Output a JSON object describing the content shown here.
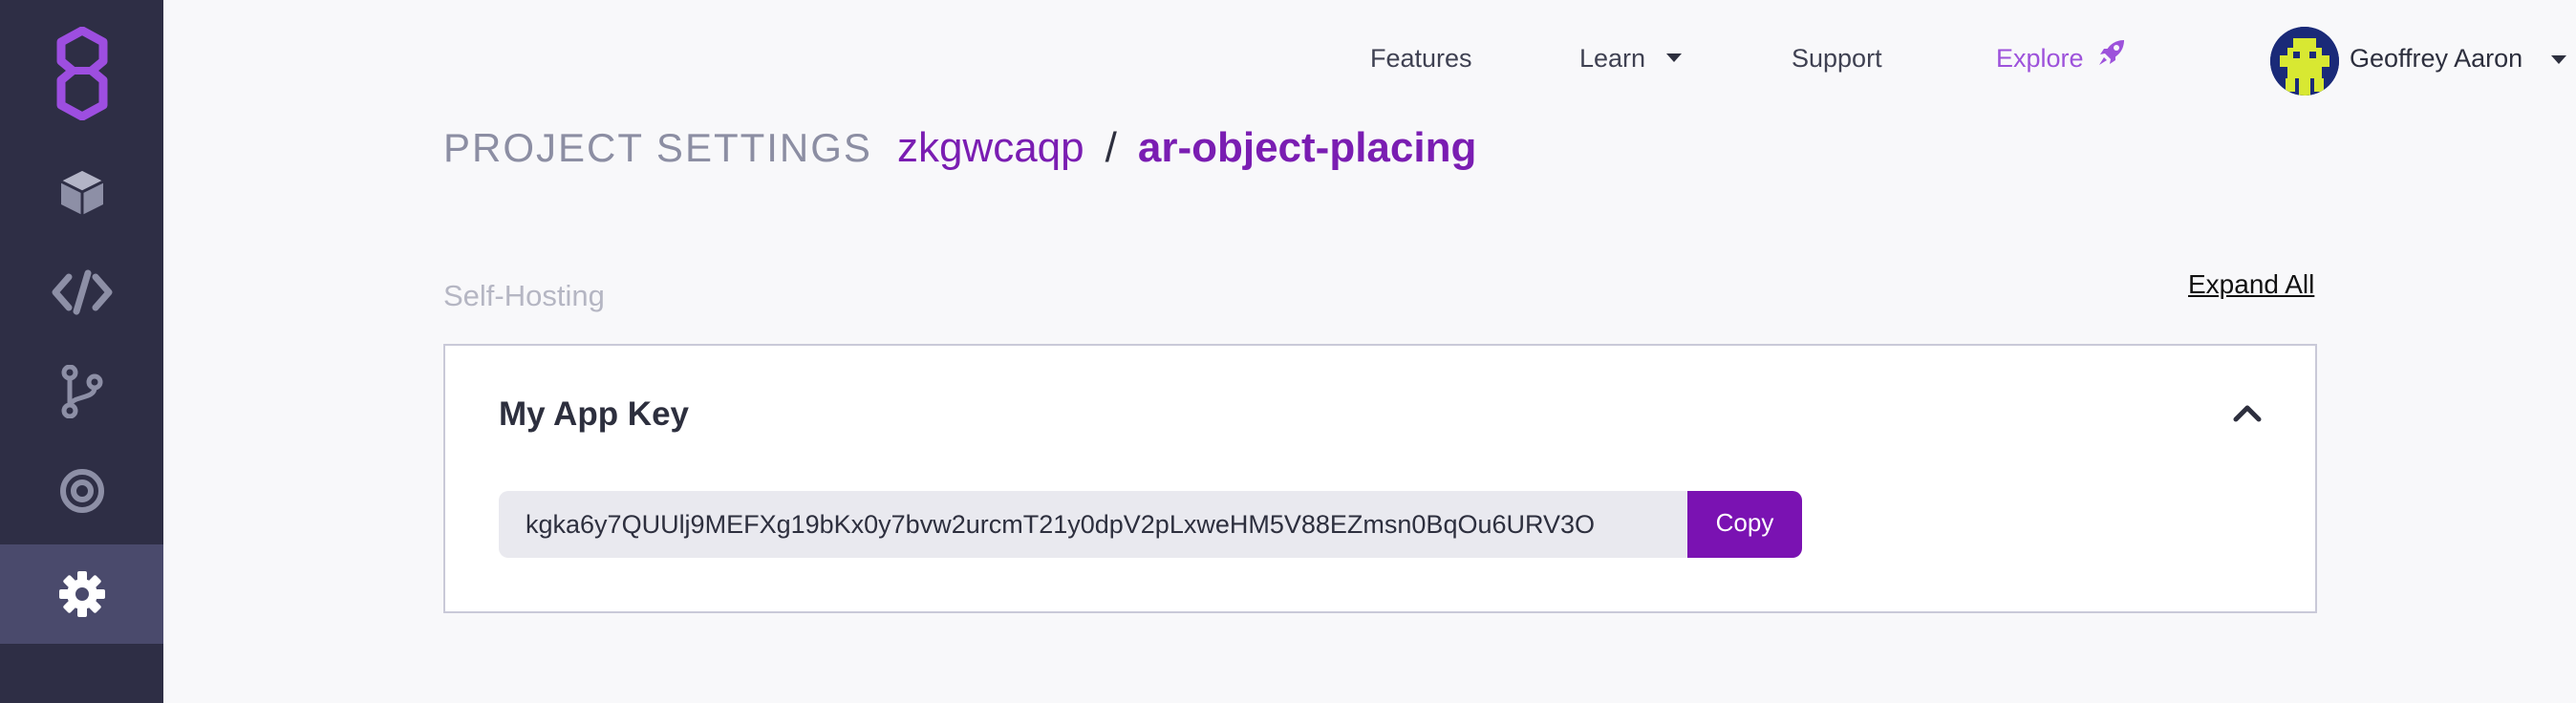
{
  "sidebar": {
    "items": [
      {
        "name": "logo-icon"
      },
      {
        "name": "cube-icon"
      },
      {
        "name": "code-icon"
      },
      {
        "name": "branch-icon"
      },
      {
        "name": "target-icon"
      },
      {
        "name": "gear-icon",
        "active": true
      }
    ]
  },
  "nav": {
    "features": "Features",
    "learn": "Learn",
    "support": "Support",
    "explore": "Explore",
    "user_name": "Geoffrey Aaron"
  },
  "page": {
    "title_label": "PROJECT SETTINGS",
    "org": "zkgwcaqp",
    "separator": "/",
    "project": "ar-object-placing",
    "section": "Self-Hosting",
    "expand_all": "Expand All"
  },
  "card": {
    "title": "My App Key",
    "key_value": "kgka6y7QUUlj9MEFXg19bKx0y7bvw2urcmT21y0dpV2pLxweHM5V88EZmsn0BqOu6URV3O",
    "copy_label": "Copy"
  },
  "colors": {
    "sidebar_bg": "#2e2e45",
    "sidebar_active": "#4a4a6c",
    "accent": "#7a1db2",
    "explore": "#9d52db"
  }
}
